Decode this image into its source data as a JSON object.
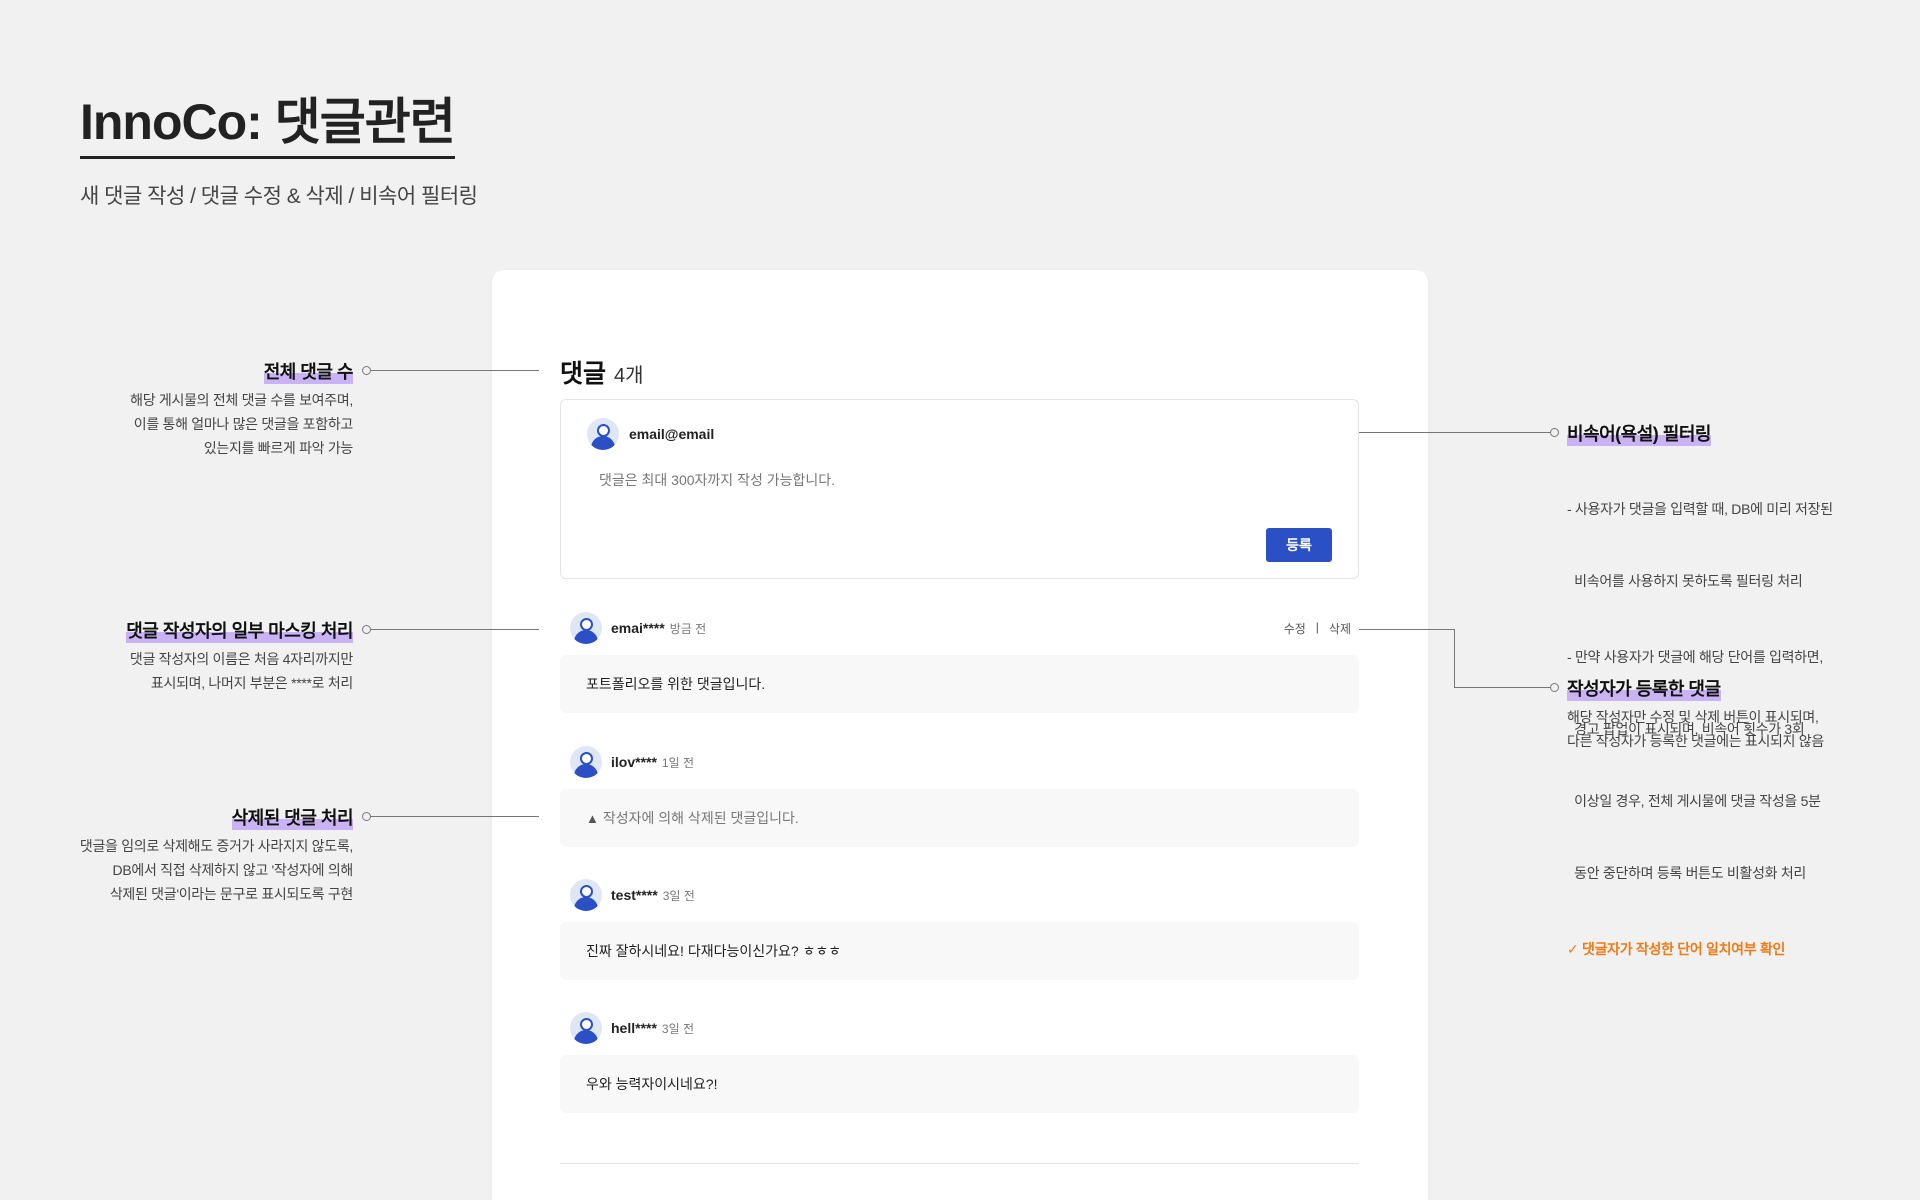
{
  "page": {
    "title": "InnoCo: 댓글관련",
    "subtitle": "새 댓글 작성 / 댓글 수정 & 삭제 / 비속어 필터링"
  },
  "comments": {
    "title": "댓글",
    "count": "4개",
    "compose": {
      "user": "email@email",
      "placeholder": "댓글은 최대 300자까지 작성 가능합니다.",
      "submit_label": "등록"
    },
    "edit_label": "수정",
    "separator": "|",
    "delete_label": "삭제",
    "items": [
      {
        "name": "emai****",
        "time": "방금 전",
        "text": "포트폴리오를 위한 댓글입니다.",
        "own": true
      },
      {
        "name": "ilov****",
        "time": "1일 전",
        "text": "작성자에 의해 삭제된 댓글입니다.",
        "deleted": true
      },
      {
        "name": "test****",
        "time": "3일 전",
        "text": "진짜 잘하시네요! 다재다능이신가요? ㅎㅎㅎ"
      },
      {
        "name": "hell****",
        "time": "3일 전",
        "text": "우와 능력자이시네요?!"
      }
    ]
  },
  "annotations": {
    "total_count": {
      "title": "전체 댓글 수",
      "lines": [
        "해당 게시물의 전체 댓글 수를 보여주며,",
        "이를 통해 얼마나 많은 댓글을 포함하고",
        "있는지를 빠르게 파악 가능"
      ]
    },
    "masking": {
      "title": "댓글 작성자의 일부 마스킹 처리",
      "lines": [
        "댓글 작성자의 이름은 처음 4자리까지만",
        "표시되며, 나머지 부분은 ****로 처리"
      ]
    },
    "deleted": {
      "title": "삭제된 댓글 처리",
      "lines": [
        "댓글을 임의로 삭제해도 증거가 사라지지 않도록,",
        "DB에서 직접 삭제하지 않고 '작성자에 의해",
        "삭제된 댓글'이라는 문구로 표시되도록 구현"
      ]
    },
    "profanity": {
      "title": "비속어(욕설) 필터링",
      "lines": [
        "- 사용자가 댓글을 입력할 때, DB에 미리 저장된",
        "  비속어를 사용하지 못하도록 필터링 처리",
        "- 만약 사용자가 댓글에 해당 단어를 입력하면,",
        "  경고 팝업이 표시되며, 비속어 횟수가 3회",
        "  이상일 경우, 전체 게시물에 댓글 작성을 5분",
        "  동안 중단하며 등록 버튼도 비활성화 처리"
      ],
      "check": "✓ 댓글자가 작성한 단어 일치여부 확인"
    },
    "own_comment": {
      "title": "작성자가 등록한 댓글",
      "lines": [
        "해당 작성자만 수정 및 삭제 버튼이 표시되며,",
        "다른 작성자가 등록한 댓글에는 표시되지 않음"
      ]
    }
  },
  "colors": {
    "accent": "#2b4fc4",
    "highlight": "#c9b3f5",
    "check": "#f07a16",
    "background": "#f1f1f1"
  },
  "icons": {
    "avatar": "user-avatar-icon",
    "warning": "warning-icon"
  }
}
